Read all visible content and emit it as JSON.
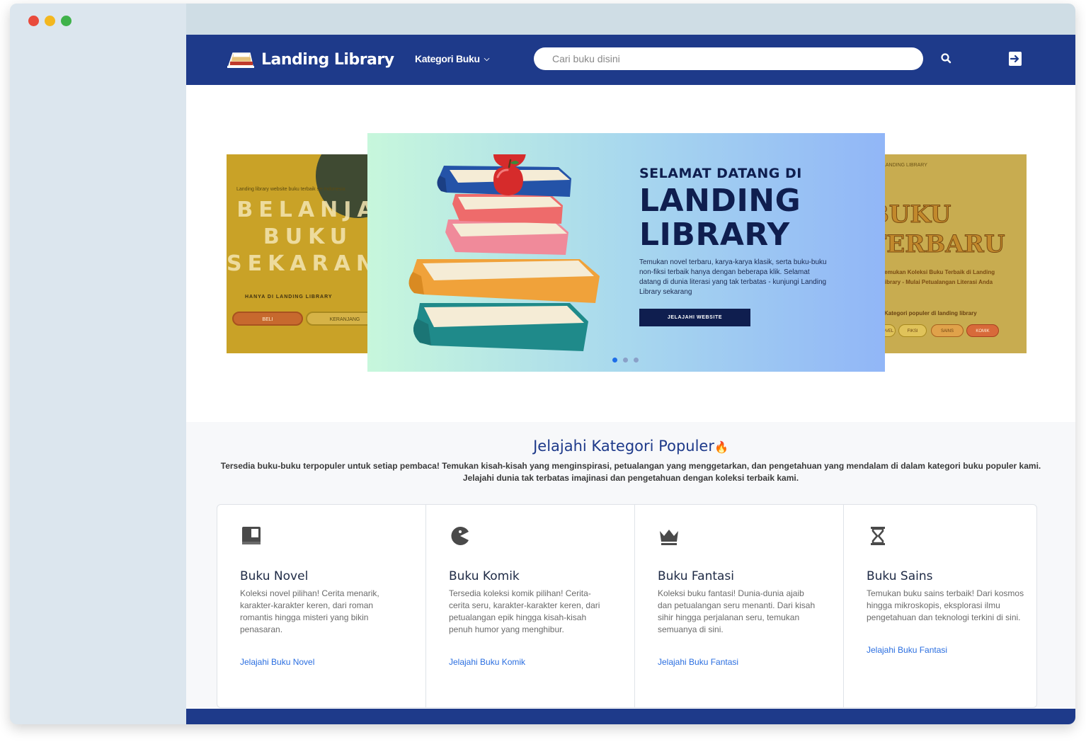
{
  "navbar": {
    "brand": "Landing Library",
    "category_menu": "Kategori Buku",
    "search_placeholder": "Cari buku disini"
  },
  "hero": {
    "main": {
      "pre_title": "SELAMAT DATANG DI",
      "title_line1": "LANDING",
      "title_line2": "LIBRARY",
      "description": "Temukan novel terbaru, karya-karya klasik, serta buku-buku non-fiksi terbaik hanya dengan beberapa klik. Selamat datang di dunia literasi yang tak terbatas - kunjungi Landing Library sekarang",
      "button": "JELAJAHI WEBSITE"
    },
    "left_slide": {
      "small": "Landing library website buku terbaik se-Indonesia",
      "line1": "BELANJA",
      "line2": "BUKU",
      "line3": "SEKARANG",
      "sub": "HANYA DI LANDING LIBRARY",
      "btn1": "BELI",
      "btn2": "KERANJANG"
    },
    "right_slide": {
      "small": "LANDING LIBRARY",
      "line1": "BUKU",
      "line2": "TERBARU",
      "sub1": "Temukan Koleksi Buku Terbaik di Landing",
      "sub2": "Library - Mulai Petualangan Literasi Anda",
      "sub3": "Kategori populer di landing library",
      "pills": [
        "NOVEL",
        "FIKSI",
        "SAINS",
        "KOMIK"
      ]
    },
    "carousel_dots": 3,
    "active_dot": 0
  },
  "categories": {
    "title": "Jelajahi Kategori Populer",
    "description": "Tersedia buku-buku terpopuler untuk setiap pembaca! Temukan kisah-kisah yang menginspirasi, petualangan yang menggetarkan, dan pengetahuan yang mendalam di dalam kategori buku populer kami. Jelajahi dunia tak terbatas imajinasi dan pengetahuan dengan koleksi terbaik kami.",
    "items": [
      {
        "icon": "book-icon",
        "title": "Buku Novel",
        "description": "Koleksi novel pilihan! Cerita menarik, karakter-karakter keren, dari roman romantis hingga misteri yang bikin penasaran.",
        "link": "Jelajahi Buku Novel"
      },
      {
        "icon": "pacman-icon",
        "title": "Buku Komik",
        "description": "Tersedia koleksi komik pilihan! Cerita-cerita seru, karakter-karakter keren, dari petualangan epik hingga kisah-kisah penuh humor yang menghibur.",
        "link": "Jelajahi Buku Komik"
      },
      {
        "icon": "crown-icon",
        "title": "Buku Fantasi",
        "description": "Koleksi buku fantasi! Dunia-dunia ajaib dan petualangan seru menanti. Dari kisah sihir hingga perjalanan seru, temukan semuanya di sini.",
        "link": "Jelajahi Buku Fantasi"
      },
      {
        "icon": "hourglass-icon",
        "title": "Buku Sains",
        "description": "Temukan buku sains terbaik! Dari kosmos hingga mikroskopis, eksplorasi ilmu pengetahuan dan teknologi terkini di sini.",
        "link": "Jelajahi Buku Fantasi"
      }
    ]
  },
  "colors": {
    "navbar": "#1e3a8a",
    "hero_title": "#0f1e4f",
    "link": "#2a6ee0",
    "footer": "#1e3a8a"
  }
}
